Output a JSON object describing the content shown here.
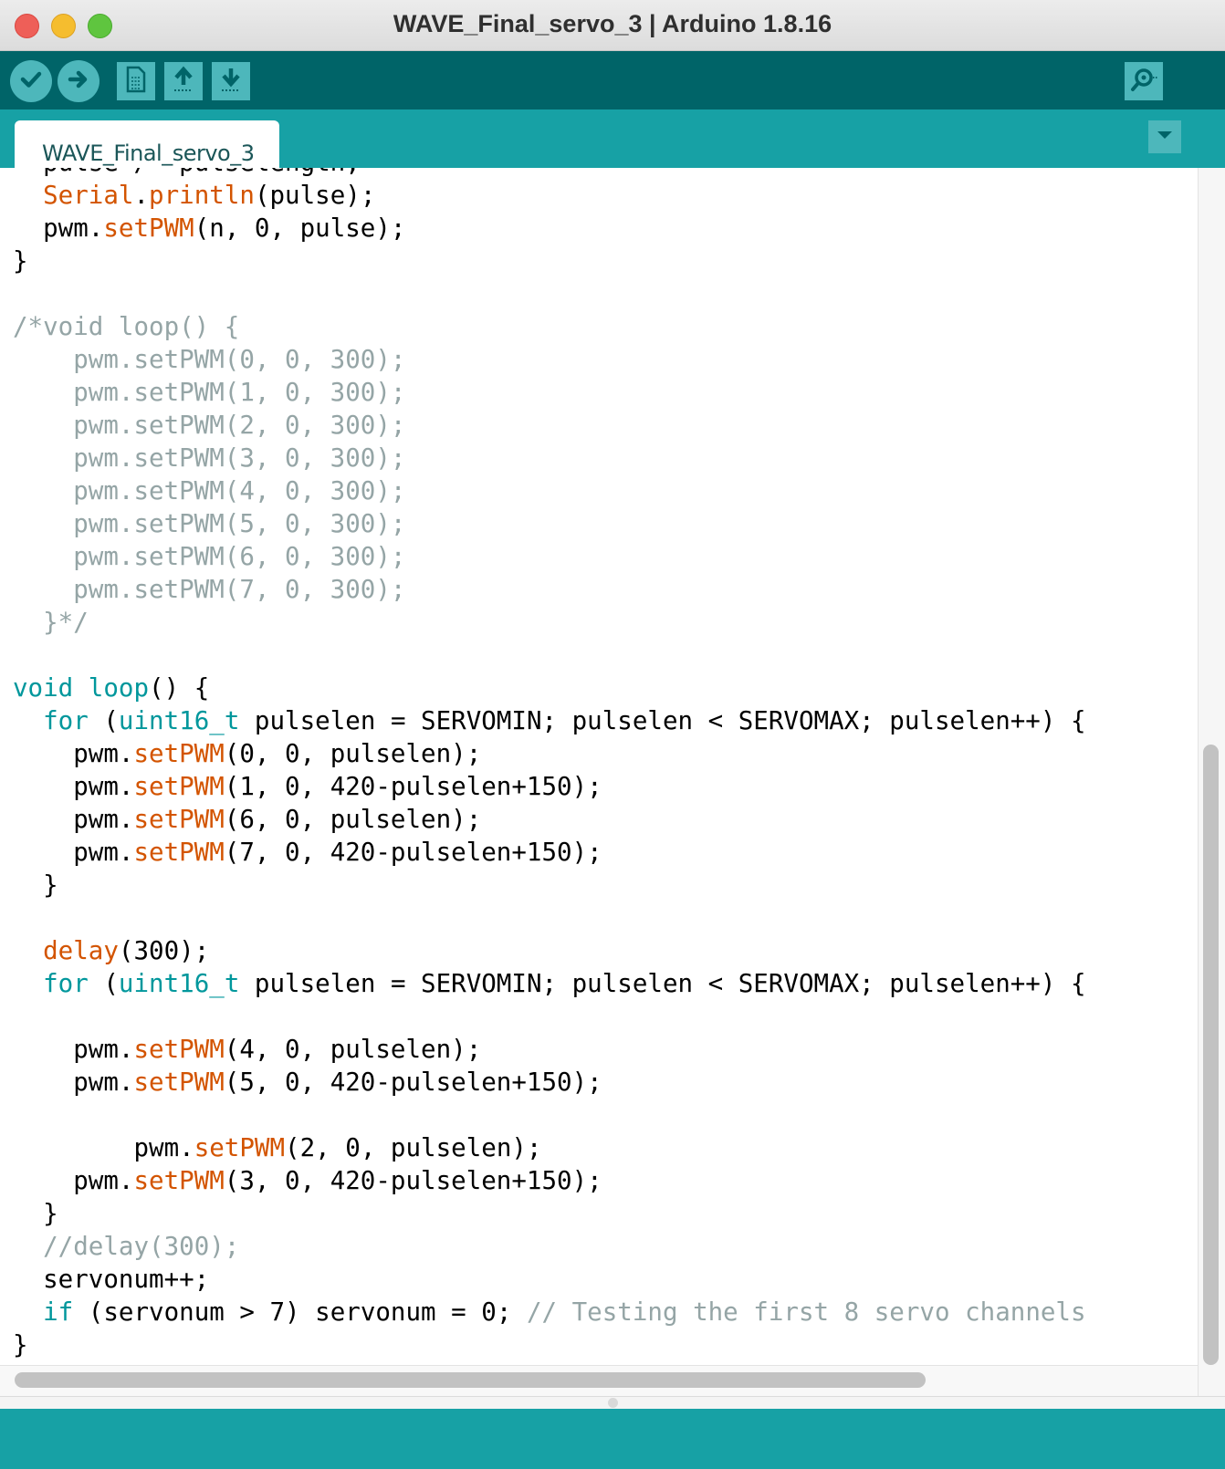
{
  "window": {
    "title": "WAVE_Final_servo_3 | Arduino 1.8.16"
  },
  "toolbar": {
    "buttons": [
      {
        "name": "verify",
        "icon": "checkmark-icon"
      },
      {
        "name": "upload",
        "icon": "arrow-right-icon"
      },
      {
        "name": "new",
        "icon": "document-icon"
      },
      {
        "name": "open",
        "icon": "arrow-up-icon"
      },
      {
        "name": "save",
        "icon": "arrow-down-icon"
      },
      {
        "name": "serial-monitor",
        "icon": "magnifier-icon"
      }
    ]
  },
  "tabs": [
    {
      "label": "WAVE_Final_servo_3"
    }
  ],
  "editor": {
    "lines": [
      "  pulse /= pulselength;",
      "  Serial.println(pulse);",
      "  pwm.setPWM(n, 0, pulse);",
      "}",
      "",
      "/*void loop() {",
      "    pwm.setPWM(0, 0, 300);",
      "    pwm.setPWM(1, 0, 300);",
      "    pwm.setPWM(2, 0, 300);",
      "    pwm.setPWM(3, 0, 300);",
      "    pwm.setPWM(4, 0, 300);",
      "    pwm.setPWM(5, 0, 300);",
      "    pwm.setPWM(6, 0, 300);",
      "    pwm.setPWM(7, 0, 300);",
      "  }*/",
      "",
      "void loop() {",
      "  for (uint16_t pulselen = SERVOMIN; pulselen < SERVOMAX; pulselen++) {",
      "    pwm.setPWM(0, 0, pulselen);",
      "    pwm.setPWM(1, 0, 420-pulselen+150);",
      "    pwm.setPWM(6, 0, pulselen);",
      "    pwm.setPWM(7, 0, 420-pulselen+150);",
      "  }",
      "",
      "  delay(300);",
      "  for (uint16_t pulselen = SERVOMIN; pulselen < SERVOMAX; pulselen++) {",
      "",
      "    pwm.setPWM(4, 0, pulselen);",
      "    pwm.setPWM(5, 0, 420-pulselen+150);",
      "",
      "        pwm.setPWM(2, 0, pulselen);",
      "    pwm.setPWM(3, 0, 420-pulselen+150);",
      "  }",
      "  //delay(300);",
      "  servonum++;",
      "  if (servonum > 7) servonum = 0; // Testing the first 8 servo channels",
      "}"
    ]
  },
  "colors": {
    "toolbar": "#006468",
    "tabbar": "#17a1a5",
    "keyword": "#00979c",
    "function": "#d35400",
    "comment": "#95a5a6"
  }
}
